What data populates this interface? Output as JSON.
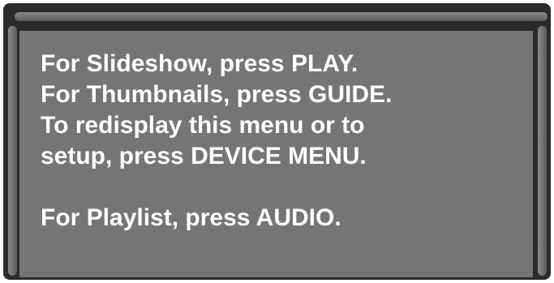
{
  "menu": {
    "lines": [
      "For Slideshow, press PLAY.",
      "For Thumbnails, press GUIDE.",
      "To redisplay this menu or to",
      "setup, press DEVICE MENU.",
      "For Playlist, press AUDIO."
    ]
  },
  "colors": {
    "frame": "#2b2b2b",
    "screen": "#757575",
    "text": "#ffffff"
  }
}
